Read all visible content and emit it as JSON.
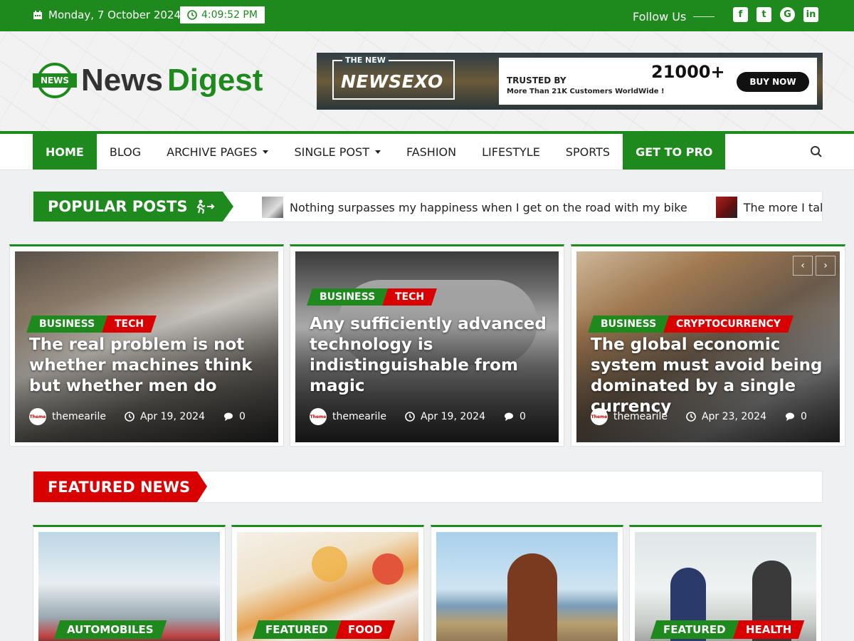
{
  "topbar": {
    "date": "Monday, 7 October 2024",
    "time": "4:09:52 PM",
    "follow_label": "Follow Us",
    "socials": [
      "facebook-icon",
      "twitter-icon",
      "google-plus-icon",
      "linkedin-icon"
    ]
  },
  "logo": {
    "part1": "News",
    "part2": "Digest",
    "badge": "NEWS"
  },
  "ad": {
    "small": "THE NEW",
    "brand": "NEWSEXO",
    "trusted": "TRUSTED BY",
    "sub": "More Than 21K Customers WorldWide !",
    "count": "21000+",
    "button": "BUY NOW"
  },
  "nav": {
    "items": [
      "HOME",
      "BLOG",
      "ARCHIVE PAGES",
      "SINGLE POST",
      "FASHION",
      "LIFESTYLE",
      "SPORTS",
      "GET TO PRO"
    ]
  },
  "popular": {
    "label": "POPULAR POSTS",
    "items": [
      "Nothing surpasses my happiness when I get on the road with my bike",
      "The more I take"
    ]
  },
  "cards": [
    {
      "tags": [
        "BUSINESS",
        "TECH"
      ],
      "title": "The real problem is not whether machines think but whether men do",
      "author": "themearile",
      "date": "Apr 19, 2024",
      "comments": "0"
    },
    {
      "tags": [
        "BUSINESS",
        "TECH"
      ],
      "title": "Any sufficiently advanced technology is indistinguishable from magic",
      "author": "themearile",
      "date": "Apr 19, 2024",
      "comments": "0"
    },
    {
      "tags": [
        "BUSINESS",
        "CRYPTOCURRENCY"
      ],
      "title": "The global economic system must avoid being dominated by a single currency",
      "author": "themearile",
      "date": "Apr 23, 2024",
      "comments": "0"
    }
  ],
  "featured": {
    "label": "FEATURED NEWS",
    "cards": [
      {
        "tags": [
          "AUTOMOBILES"
        ]
      },
      {
        "tags": [
          "FEATURED",
          "FOOD"
        ]
      },
      {
        "tags": []
      },
      {
        "tags": [
          "FEATURED",
          "HEALTH"
        ]
      }
    ]
  },
  "colors": {
    "brand_green": "#1e8a1e",
    "accent_red": "#d80000"
  }
}
